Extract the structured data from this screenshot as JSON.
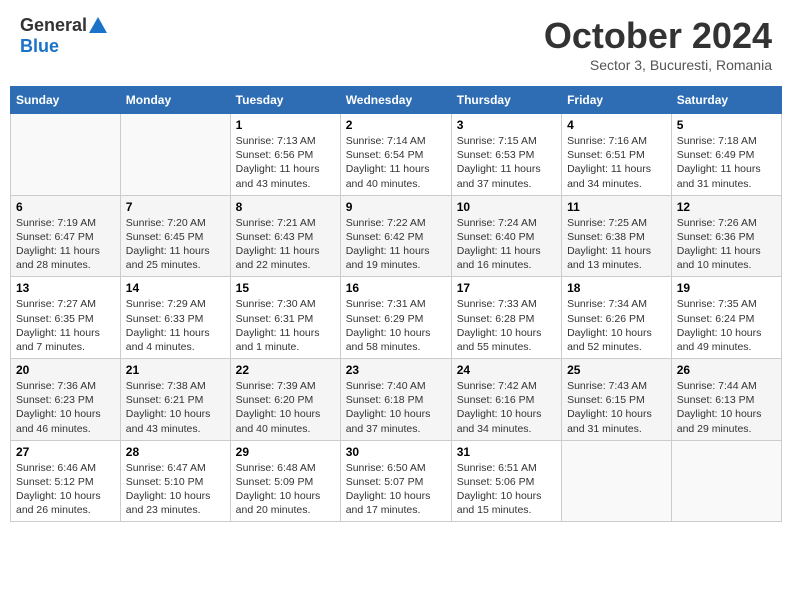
{
  "header": {
    "logo_general": "General",
    "logo_blue": "Blue",
    "month": "October 2024",
    "location": "Sector 3, Bucuresti, Romania"
  },
  "days_of_week": [
    "Sunday",
    "Monday",
    "Tuesday",
    "Wednesday",
    "Thursday",
    "Friday",
    "Saturday"
  ],
  "weeks": [
    [
      {
        "day": "",
        "info": ""
      },
      {
        "day": "",
        "info": ""
      },
      {
        "day": "1",
        "info": "Sunrise: 7:13 AM\nSunset: 6:56 PM\nDaylight: 11 hours and 43 minutes."
      },
      {
        "day": "2",
        "info": "Sunrise: 7:14 AM\nSunset: 6:54 PM\nDaylight: 11 hours and 40 minutes."
      },
      {
        "day": "3",
        "info": "Sunrise: 7:15 AM\nSunset: 6:53 PM\nDaylight: 11 hours and 37 minutes."
      },
      {
        "day": "4",
        "info": "Sunrise: 7:16 AM\nSunset: 6:51 PM\nDaylight: 11 hours and 34 minutes."
      },
      {
        "day": "5",
        "info": "Sunrise: 7:18 AM\nSunset: 6:49 PM\nDaylight: 11 hours and 31 minutes."
      }
    ],
    [
      {
        "day": "6",
        "info": "Sunrise: 7:19 AM\nSunset: 6:47 PM\nDaylight: 11 hours and 28 minutes."
      },
      {
        "day": "7",
        "info": "Sunrise: 7:20 AM\nSunset: 6:45 PM\nDaylight: 11 hours and 25 minutes."
      },
      {
        "day": "8",
        "info": "Sunrise: 7:21 AM\nSunset: 6:43 PM\nDaylight: 11 hours and 22 minutes."
      },
      {
        "day": "9",
        "info": "Sunrise: 7:22 AM\nSunset: 6:42 PM\nDaylight: 11 hours and 19 minutes."
      },
      {
        "day": "10",
        "info": "Sunrise: 7:24 AM\nSunset: 6:40 PM\nDaylight: 11 hours and 16 minutes."
      },
      {
        "day": "11",
        "info": "Sunrise: 7:25 AM\nSunset: 6:38 PM\nDaylight: 11 hours and 13 minutes."
      },
      {
        "day": "12",
        "info": "Sunrise: 7:26 AM\nSunset: 6:36 PM\nDaylight: 11 hours and 10 minutes."
      }
    ],
    [
      {
        "day": "13",
        "info": "Sunrise: 7:27 AM\nSunset: 6:35 PM\nDaylight: 11 hours and 7 minutes."
      },
      {
        "day": "14",
        "info": "Sunrise: 7:29 AM\nSunset: 6:33 PM\nDaylight: 11 hours and 4 minutes."
      },
      {
        "day": "15",
        "info": "Sunrise: 7:30 AM\nSunset: 6:31 PM\nDaylight: 11 hours and 1 minute."
      },
      {
        "day": "16",
        "info": "Sunrise: 7:31 AM\nSunset: 6:29 PM\nDaylight: 10 hours and 58 minutes."
      },
      {
        "day": "17",
        "info": "Sunrise: 7:33 AM\nSunset: 6:28 PM\nDaylight: 10 hours and 55 minutes."
      },
      {
        "day": "18",
        "info": "Sunrise: 7:34 AM\nSunset: 6:26 PM\nDaylight: 10 hours and 52 minutes."
      },
      {
        "day": "19",
        "info": "Sunrise: 7:35 AM\nSunset: 6:24 PM\nDaylight: 10 hours and 49 minutes."
      }
    ],
    [
      {
        "day": "20",
        "info": "Sunrise: 7:36 AM\nSunset: 6:23 PM\nDaylight: 10 hours and 46 minutes."
      },
      {
        "day": "21",
        "info": "Sunrise: 7:38 AM\nSunset: 6:21 PM\nDaylight: 10 hours and 43 minutes."
      },
      {
        "day": "22",
        "info": "Sunrise: 7:39 AM\nSunset: 6:20 PM\nDaylight: 10 hours and 40 minutes."
      },
      {
        "day": "23",
        "info": "Sunrise: 7:40 AM\nSunset: 6:18 PM\nDaylight: 10 hours and 37 minutes."
      },
      {
        "day": "24",
        "info": "Sunrise: 7:42 AM\nSunset: 6:16 PM\nDaylight: 10 hours and 34 minutes."
      },
      {
        "day": "25",
        "info": "Sunrise: 7:43 AM\nSunset: 6:15 PM\nDaylight: 10 hours and 31 minutes."
      },
      {
        "day": "26",
        "info": "Sunrise: 7:44 AM\nSunset: 6:13 PM\nDaylight: 10 hours and 29 minutes."
      }
    ],
    [
      {
        "day": "27",
        "info": "Sunrise: 6:46 AM\nSunset: 5:12 PM\nDaylight: 10 hours and 26 minutes."
      },
      {
        "day": "28",
        "info": "Sunrise: 6:47 AM\nSunset: 5:10 PM\nDaylight: 10 hours and 23 minutes."
      },
      {
        "day": "29",
        "info": "Sunrise: 6:48 AM\nSunset: 5:09 PM\nDaylight: 10 hours and 20 minutes."
      },
      {
        "day": "30",
        "info": "Sunrise: 6:50 AM\nSunset: 5:07 PM\nDaylight: 10 hours and 17 minutes."
      },
      {
        "day": "31",
        "info": "Sunrise: 6:51 AM\nSunset: 5:06 PM\nDaylight: 10 hours and 15 minutes."
      },
      {
        "day": "",
        "info": ""
      },
      {
        "day": "",
        "info": ""
      }
    ]
  ]
}
